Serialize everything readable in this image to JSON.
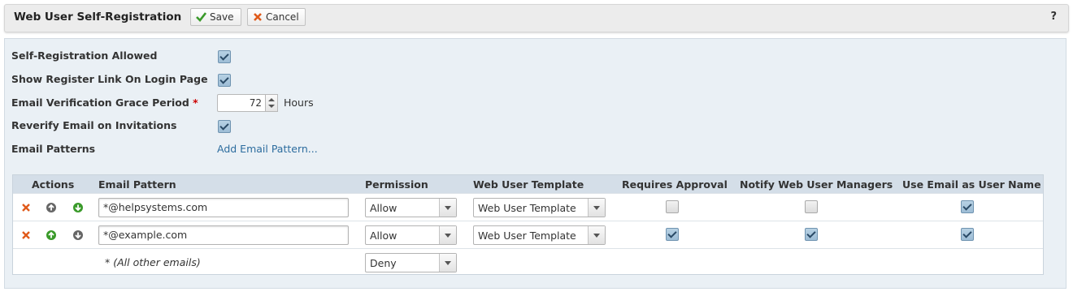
{
  "header": {
    "title": "Web User Self-Registration",
    "save_label": "Save",
    "cancel_label": "Cancel",
    "help_label": "?"
  },
  "form": {
    "self_registration": {
      "label": "Self-Registration Allowed",
      "checked": true
    },
    "show_register_link": {
      "label": "Show Register Link On Login Page",
      "checked": true
    },
    "grace_period": {
      "label": "Email Verification Grace Period",
      "required_mark": "*",
      "value": "72",
      "unit": "Hours"
    },
    "reverify": {
      "label": "Reverify Email on Invitations",
      "checked": true
    },
    "email_patterns": {
      "label": "Email Patterns",
      "add_link": "Add Email Pattern..."
    }
  },
  "grid": {
    "columns": [
      "Actions",
      "Email Pattern",
      "Permission",
      "Web User Template",
      "Requires Approval",
      "Notify Web User Managers",
      "Use Email as User Name"
    ],
    "rows": [
      {
        "pattern": "*@helpsystems.com",
        "permission": "Allow",
        "template": "Web User Template",
        "requires_approval": false,
        "notify_managers": false,
        "use_email_as_username": true,
        "up_enabled": false,
        "down_enabled": true
      },
      {
        "pattern": "*@example.com",
        "permission": "Allow",
        "template": "Web User Template",
        "requires_approval": true,
        "notify_managers": true,
        "use_email_as_username": true,
        "up_enabled": true,
        "down_enabled": false
      }
    ],
    "default_row": {
      "label": "* (All other emails)",
      "permission": "Deny"
    }
  },
  "colors": {
    "accent_link": "#2c6c9e",
    "delete": "#e05a1a",
    "move_enabled": "#3a9a2a",
    "move_disabled": "#666666"
  }
}
